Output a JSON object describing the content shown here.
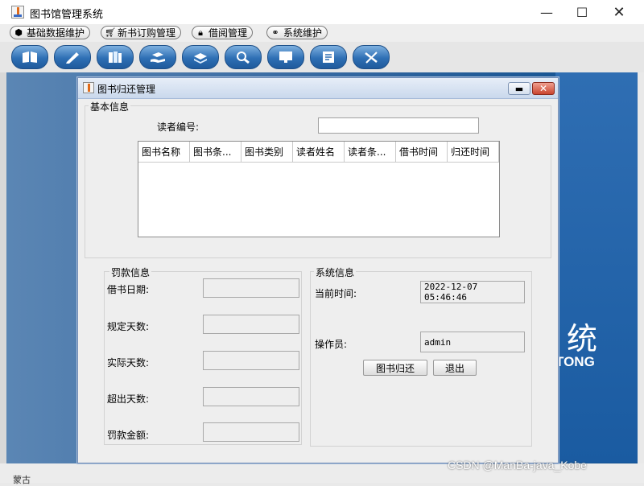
{
  "window": {
    "title": "图书馆管理系统",
    "controls": {
      "minimize": "—",
      "maximize": "☐",
      "close": "✕"
    }
  },
  "menus": [
    {
      "label": "基础数据维护",
      "icon": "cube-icon"
    },
    {
      "label": "新书订购管理",
      "icon": "cart-icon"
    },
    {
      "label": "借阅管理",
      "icon": "lock-icon"
    },
    {
      "label": "系统维护",
      "icon": "link-icon"
    }
  ],
  "toolbar": {
    "buttons": [
      {
        "icon": "open-book-icon"
      },
      {
        "icon": "pen-icon"
      },
      {
        "icon": "books-icon"
      },
      {
        "icon": "hand-book-icon"
      },
      {
        "icon": "stack-icon"
      },
      {
        "icon": "magnifier-icon"
      },
      {
        "icon": "monitor-icon"
      },
      {
        "icon": "notepad-icon"
      },
      {
        "icon": "tools-icon"
      }
    ]
  },
  "desktop": {
    "brand_cn": "统",
    "brand_en": "TONG",
    "bottom_text": "蒙古",
    "watermark": "CSDN @ManBa-java_Kobe"
  },
  "dialog": {
    "title": "图书归还管理",
    "min_glyph": "▬",
    "close_glyph": "✕",
    "basic": {
      "title": "基本信息",
      "reader_no_label": "读者编号:",
      "reader_no_value": "",
      "columns": [
        "图书名称",
        "图书条...",
        "图书类别",
        "读者姓名",
        "读者条...",
        "借书时间",
        "归还时间"
      ]
    },
    "fine": {
      "title": "罚款信息",
      "fields": [
        {
          "label": "借书日期:",
          "value": ""
        },
        {
          "label": "规定天数:",
          "value": ""
        },
        {
          "label": "实际天数:",
          "value": ""
        },
        {
          "label": "超出天数:",
          "value": ""
        },
        {
          "label": "罚款金额:",
          "value": ""
        }
      ]
    },
    "system": {
      "title": "系统信息",
      "time_label": "当前时间:",
      "time_value": "2022-12-07 05:46:46",
      "operator_label": "操作员:",
      "operator_value": "admin",
      "return_button": "图书归还",
      "exit_button": "退出"
    }
  }
}
